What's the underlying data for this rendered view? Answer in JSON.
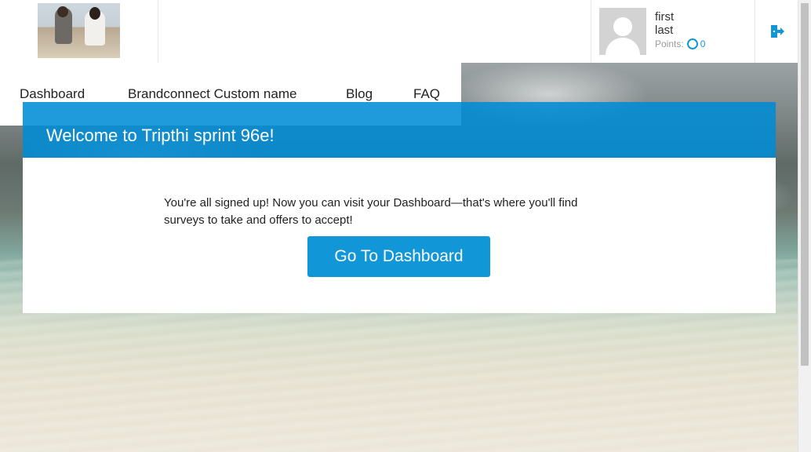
{
  "header": {
    "logo_alt": "Two women sitting on a dock",
    "user": {
      "first_name": "first",
      "last_name": "last",
      "points_label": "Points:",
      "points_value": "0"
    },
    "logout_icon": "logout-icon"
  },
  "nav": {
    "items": [
      {
        "label": "Dashboard"
      },
      {
        "label": "Brandconnect Custom name"
      },
      {
        "label": "Blog"
      },
      {
        "label": "FAQ"
      }
    ]
  },
  "welcome": {
    "title": "Welcome to Tripthi sprint 96e!",
    "message": "You're all signed up! Now you can visit your Dashboard—that's where you'll find surveys to take and offers to accept!",
    "cta_label": "Go To Dashboard"
  },
  "colors": {
    "accent": "#1196d8",
    "header_band": "#008cd6"
  }
}
